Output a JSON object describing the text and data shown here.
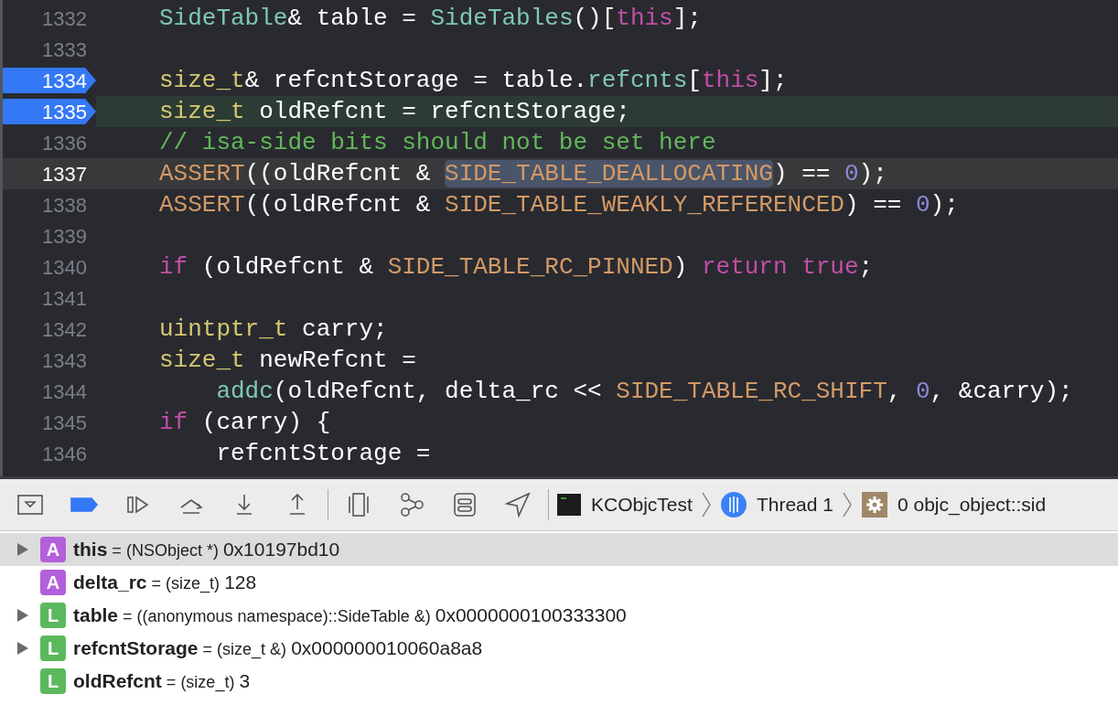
{
  "editor": {
    "lines": [
      {
        "number": "1332",
        "breakpoint": false,
        "executing": false,
        "cursor": false,
        "tokens": [
          {
            "kind": "member",
            "text": "SideTable"
          },
          {
            "kind": "plain",
            "text": "& table = "
          },
          {
            "kind": "member",
            "text": "SideTables"
          },
          {
            "kind": "plain",
            "text": "()["
          },
          {
            "kind": "keyword",
            "text": "this"
          },
          {
            "kind": "plain",
            "text": "];"
          }
        ]
      },
      {
        "number": "1333",
        "breakpoint": false,
        "executing": false,
        "cursor": false
      },
      {
        "number": "1334",
        "breakpoint": true,
        "executing": false,
        "cursor": false,
        "tokens": [
          {
            "kind": "type",
            "text": "size_t"
          },
          {
            "kind": "plain",
            "text": "& refcntStorage = table."
          },
          {
            "kind": "member",
            "text": "refcnts"
          },
          {
            "kind": "plain",
            "text": "["
          },
          {
            "kind": "keyword",
            "text": "this"
          },
          {
            "kind": "plain",
            "text": "];"
          }
        ]
      },
      {
        "number": "1335",
        "breakpoint": true,
        "executing": true,
        "cursor": false,
        "tokens": [
          {
            "kind": "type",
            "text": "size_t"
          },
          {
            "kind": "plain",
            "text": " oldRefcnt = refcntStorage;"
          }
        ]
      },
      {
        "number": "1336",
        "breakpoint": false,
        "executing": false,
        "cursor": false,
        "tokens": [
          {
            "kind": "comment",
            "text": "// isa-side bits should not be set here"
          }
        ]
      },
      {
        "number": "1337",
        "breakpoint": false,
        "executing": false,
        "cursor": true,
        "tokens": [
          {
            "kind": "macro",
            "text": "ASSERT",
            "highlighted": false
          },
          {
            "kind": "plain",
            "text": "((oldRefcnt & ",
            "highlighted": false
          },
          {
            "kind": "macro",
            "text": "SIDE_TABLE_DEALLOCATING",
            "highlighted": true
          },
          {
            "kind": "plain",
            "text": ") == ",
            "highlighted": false
          },
          {
            "kind": "number",
            "text": "0",
            "highlighted": false
          },
          {
            "kind": "plain",
            "text": ");",
            "highlighted": false
          }
        ]
      },
      {
        "number": "1338",
        "breakpoint": false,
        "executing": false,
        "cursor": false,
        "tokens": [
          {
            "kind": "macro",
            "text": "ASSERT"
          },
          {
            "kind": "plain",
            "text": "((oldRefcnt & "
          },
          {
            "kind": "macro",
            "text": "SIDE_TABLE_WEAKLY_REFERENCED"
          },
          {
            "kind": "plain",
            "text": ") == "
          },
          {
            "kind": "number",
            "text": "0"
          },
          {
            "kind": "plain",
            "text": ");"
          }
        ]
      },
      {
        "number": "1339",
        "breakpoint": false,
        "executing": false,
        "cursor": false
      },
      {
        "number": "1340",
        "breakpoint": false,
        "executing": false,
        "cursor": false,
        "tokens": [
          {
            "kind": "keyword",
            "text": "if"
          },
          {
            "kind": "plain",
            "text": " (oldRefcnt & "
          },
          {
            "kind": "macro",
            "text": "SIDE_TABLE_RC_PINNED"
          },
          {
            "kind": "plain",
            "text": ") "
          },
          {
            "kind": "keyword",
            "text": "return true"
          },
          {
            "kind": "plain",
            "text": ";"
          }
        ]
      },
      {
        "number": "1341",
        "breakpoint": false,
        "executing": false,
        "cursor": false
      },
      {
        "number": "1342",
        "breakpoint": false,
        "executing": false,
        "cursor": false,
        "tokens": [
          {
            "kind": "type",
            "text": "uintptr_t"
          },
          {
            "kind": "plain",
            "text": " carry;"
          }
        ]
      },
      {
        "number": "1343",
        "breakpoint": false,
        "executing": false,
        "cursor": false,
        "tokens": [
          {
            "kind": "type",
            "text": "size_t"
          },
          {
            "kind": "plain",
            "text": " newRefcnt ="
          }
        ]
      },
      {
        "number": "1344",
        "breakpoint": false,
        "executing": false,
        "cursor": false,
        "tokens": [
          {
            "kind": "member",
            "text": "    addc"
          },
          {
            "kind": "plain",
            "text": "(oldRefcnt, delta_rc << "
          },
          {
            "kind": "macro",
            "text": "SIDE_TABLE_RC_SHIFT"
          },
          {
            "kind": "plain",
            "text": ", "
          },
          {
            "kind": "number",
            "text": "0"
          },
          {
            "kind": "plain",
            "text": ", &carry);"
          }
        ]
      },
      {
        "number": "1345",
        "breakpoint": false,
        "executing": false,
        "cursor": false,
        "tokens": [
          {
            "kind": "keyword",
            "text": "if"
          },
          {
            "kind": "plain",
            "text": " (carry) {"
          }
        ]
      },
      {
        "number": "1346",
        "breakpoint": false,
        "executing": false,
        "cursor": false,
        "tokens": [
          {
            "kind": "plain",
            "text": "    refcntStorage ="
          }
        ]
      }
    ]
  },
  "debug_bar": {
    "breakpoints_active": true,
    "breadcrumbs": [
      {
        "kind": "process",
        "label": "KCObjcTest"
      },
      {
        "kind": "thread",
        "label": "Thread 1"
      },
      {
        "kind": "frame",
        "label": "0 objc_object::sid"
      }
    ]
  },
  "variables": [
    {
      "kind": "argument",
      "badge": "A",
      "name": "this",
      "operator": "=",
      "type": "(NSObject *)",
      "value": "0x10197bd10",
      "expandable": true,
      "selected": true
    },
    {
      "kind": "argument",
      "badge": "A",
      "name": "delta_rc",
      "operator": "=",
      "type": "(size_t)",
      "value": "128",
      "expandable": false,
      "selected": false
    },
    {
      "kind": "local",
      "badge": "L",
      "name": "table",
      "operator": "=",
      "type": "((anonymous namespace)::SideTable &)",
      "value": "0x0000000100333300",
      "expandable": true,
      "selected": false
    },
    {
      "kind": "local",
      "badge": "L",
      "name": "refcntStorage",
      "operator": "=",
      "type": "(size_t &)",
      "value": "0x000000010060a8a8",
      "expandable": true,
      "selected": false
    },
    {
      "kind": "local",
      "badge": "L",
      "name": "oldRefcnt",
      "operator": "=",
      "type": "(size_t)",
      "value": "3",
      "expandable": false,
      "selected": false
    }
  ]
}
